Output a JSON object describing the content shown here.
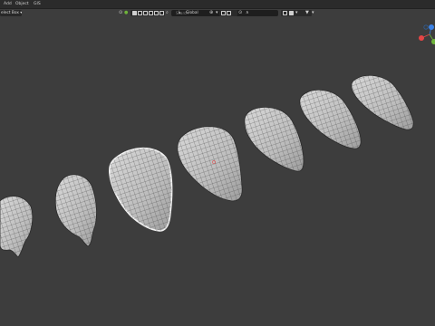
{
  "menubar": {
    "items": [
      "Add",
      "Object",
      "GIS"
    ]
  },
  "header": {
    "select_mode": "elect Box ▾",
    "search_placeholder": "Search",
    "orientation_label": "Global",
    "icons": [
      "eye-icon",
      "snap-icon",
      "proportional-icon",
      "filter-icon"
    ]
  },
  "gizmo": {
    "axis_colors": {
      "x": "#e64545",
      "y": "#6fb43a",
      "z": "#3b82e6"
    }
  },
  "scene": {
    "background": "#3d3d3d",
    "objects": [
      "mesh-1",
      "mesh-2",
      "mesh-3-selected",
      "mesh-4",
      "mesh-5",
      "mesh-6",
      "mesh-7"
    ],
    "selected_object": "mesh-3-selected"
  }
}
